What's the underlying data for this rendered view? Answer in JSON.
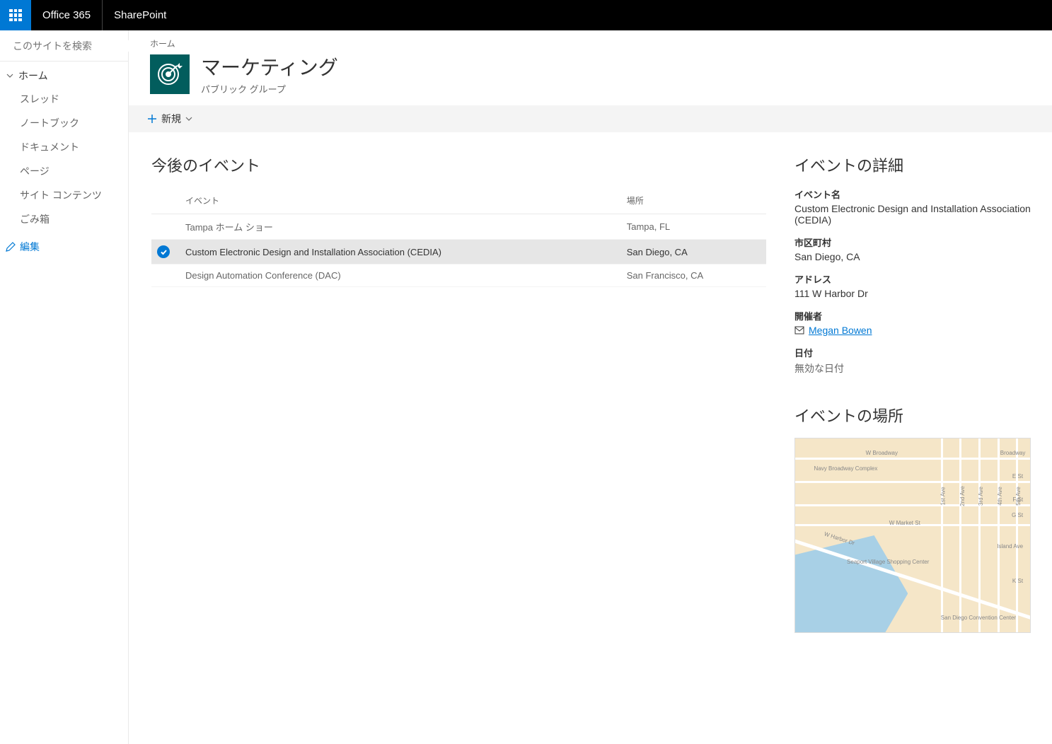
{
  "topbar": {
    "brand": "Office 365",
    "product": "SharePoint"
  },
  "search": {
    "placeholder": "このサイトを検索"
  },
  "nav": {
    "header": "ホーム",
    "items": [
      "スレッド",
      "ノートブック",
      "ドキュメント",
      "ページ",
      "サイト コンテンツ",
      "ごみ箱"
    ],
    "edit": "編集"
  },
  "breadcrumb": "ホーム",
  "site": {
    "title": "マーケティング",
    "subtitle": "パブリック グループ"
  },
  "cmdbar": {
    "new": "新規"
  },
  "events": {
    "heading": "今後のイベント",
    "cols": {
      "event": "イベント",
      "location": "場所"
    },
    "rows": [
      {
        "name": "Tampa ホーム ショー",
        "loc": "Tampa, FL",
        "selected": false
      },
      {
        "name": "Custom Electronic Design and Installation Association (CEDIA)",
        "loc": "San Diego, CA",
        "selected": true
      },
      {
        "name": "Design Automation Conference (DAC)",
        "loc": "San Francisco, CA",
        "selected": false
      }
    ]
  },
  "detail": {
    "heading": "イベントの詳細",
    "fields": {
      "name_label": "イベント名",
      "name_value": "Custom Electronic Design and Installation Association (CEDIA)",
      "city_label": "市区町村",
      "city_value": "San Diego, CA",
      "addr_label": "アドレス",
      "addr_value": "111 W Harbor Dr",
      "org_label": "開催者",
      "org_value": "Megan Bowen",
      "date_label": "日付",
      "date_value": "無効な日付"
    }
  },
  "map": {
    "heading": "イベントの場所",
    "labels": [
      "W Broadway",
      "Broadway",
      "E St",
      "F St",
      "G St",
      "W Market St",
      "W Harbor Dr",
      "Navy Broadway Complex",
      "Seaport Village Shopping Center",
      "San Diego Convention Center",
      "K St",
      "Island Ave",
      "1st Ave",
      "2nd Ave",
      "3rd Ave",
      "4th Ave",
      "5th Ave"
    ]
  }
}
